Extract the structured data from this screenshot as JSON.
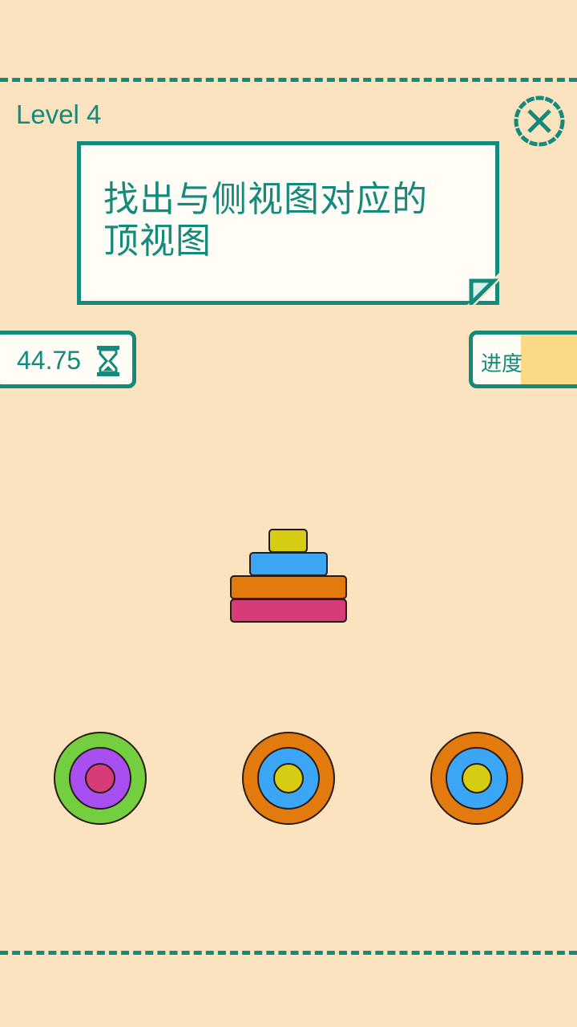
{
  "header": {
    "level_label": "Level 4"
  },
  "instruction": {
    "line1": "找出与侧视图对应的",
    "line2": "顶视图"
  },
  "timer": {
    "value": "44.75",
    "icon": "hourglass-icon"
  },
  "progress": {
    "label": "进度",
    "fraction": 0.6
  },
  "side_view": {
    "disks": [
      {
        "name": "yellow-disk",
        "color": "#d6cc12"
      },
      {
        "name": "blue-disk",
        "color": "#3ba6f6"
      },
      {
        "name": "orange-disk",
        "color": "#e37a0e"
      },
      {
        "name": "pink-disk",
        "color": "#d63c78"
      }
    ]
  },
  "options": [
    {
      "name": "option-1",
      "rings": [
        "#73cf3f",
        "#a84ff1",
        "#d63c78"
      ]
    },
    {
      "name": "option-2",
      "rings": [
        "#e37a0e",
        "#3ba6f6",
        "#d6cc12"
      ]
    },
    {
      "name": "option-3",
      "rings": [
        "#e37a0e",
        "#3ba6f6",
        "#d6cc12"
      ]
    }
  ],
  "colors": {
    "accent": "#128a7c",
    "background": "#fae3be",
    "card": "#fffdf6"
  }
}
